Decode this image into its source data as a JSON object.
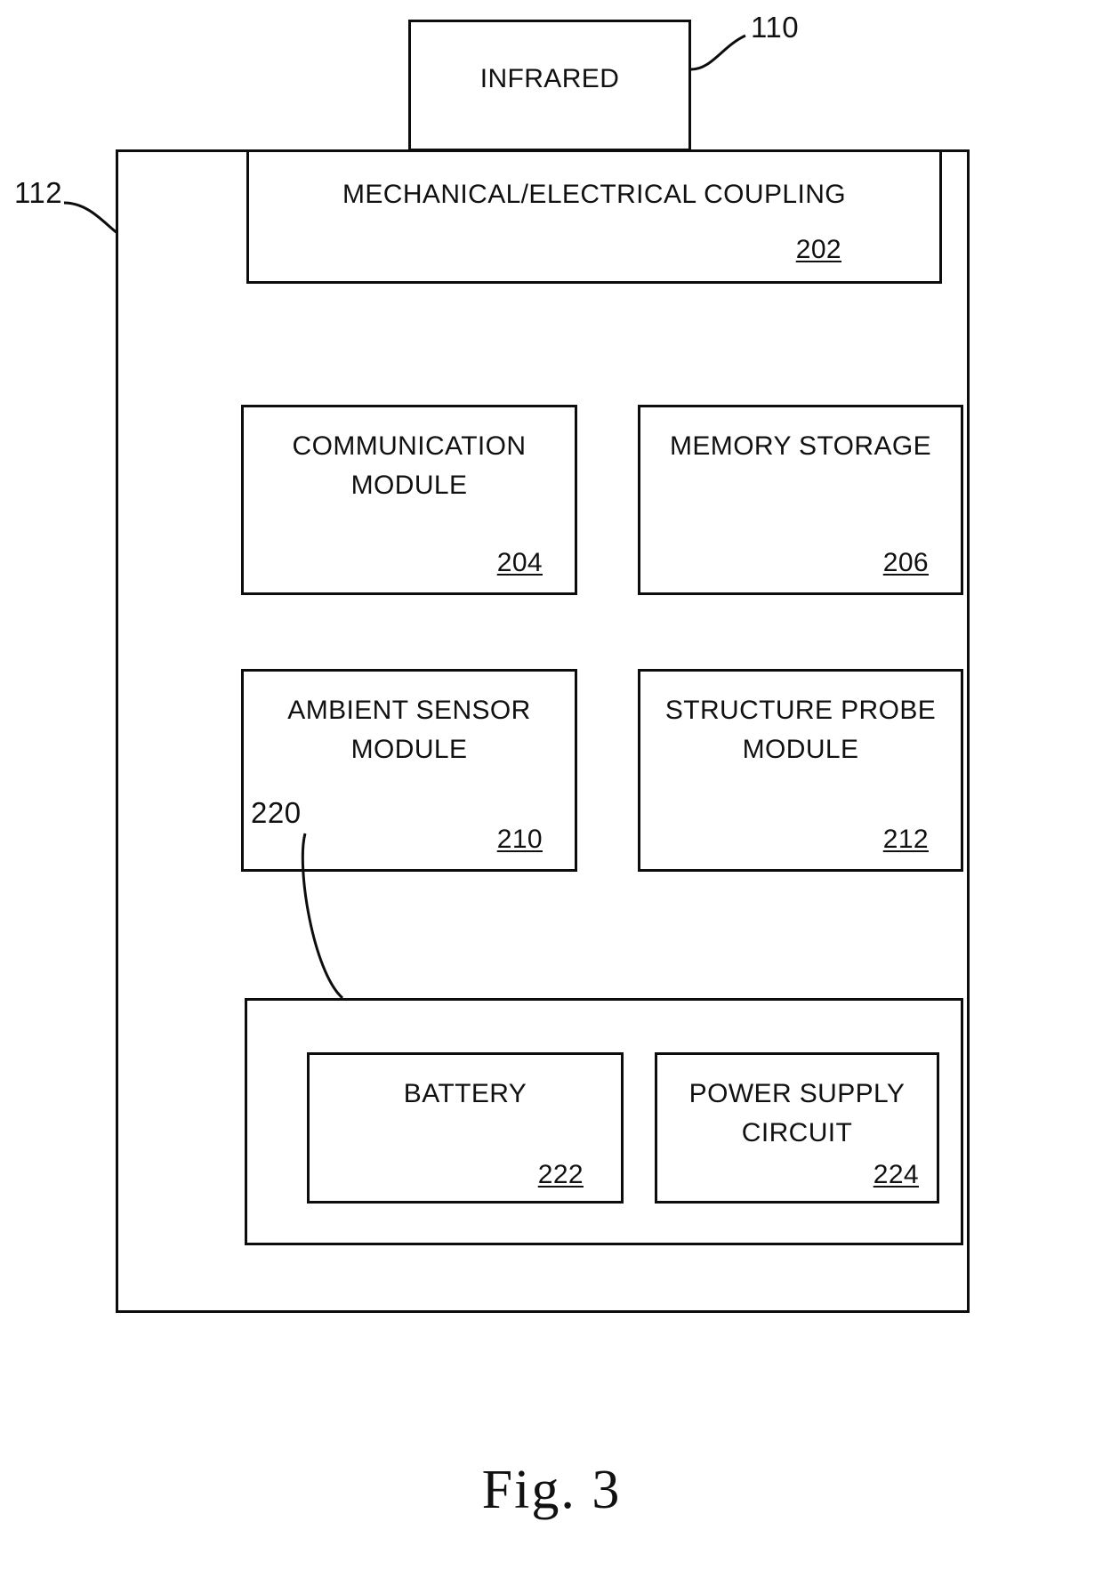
{
  "figure": {
    "caption": "Fig. 3",
    "callouts": [
      {
        "id": "110",
        "label": "110",
        "points_to": "infrared-box"
      },
      {
        "id": "112",
        "label": "112",
        "points_to": "main-housing-box"
      },
      {
        "id": "220",
        "label": "220",
        "points_to": "power-group-box"
      }
    ]
  },
  "blocks": {
    "infrared": {
      "title": "INFRARED",
      "ref": ""
    },
    "main_housing": {
      "title": "",
      "ref": ""
    },
    "coupling": {
      "title": "MECHANICAL/ELECTRICAL COUPLING",
      "ref": "202"
    },
    "communication": {
      "title": "COMMUNICATION\nMODULE",
      "ref": "204"
    },
    "memory": {
      "title": "MEMORY STORAGE",
      "ref": "206"
    },
    "ambient": {
      "title": "AMBIENT SENSOR\nMODULE",
      "ref": "210"
    },
    "structure": {
      "title": "STRUCTURE PROBE\nMODULE",
      "ref": "212"
    },
    "power_group": {
      "title": "",
      "ref": "220"
    },
    "battery": {
      "title": "BATTERY",
      "ref": "222"
    },
    "power_supply": {
      "title": "POWER SUPPLY\nCIRCUIT",
      "ref": "224"
    }
  },
  "style": {
    "line_color": "#0d0d0d",
    "background": "#ffffff",
    "text_color": "#111111"
  }
}
